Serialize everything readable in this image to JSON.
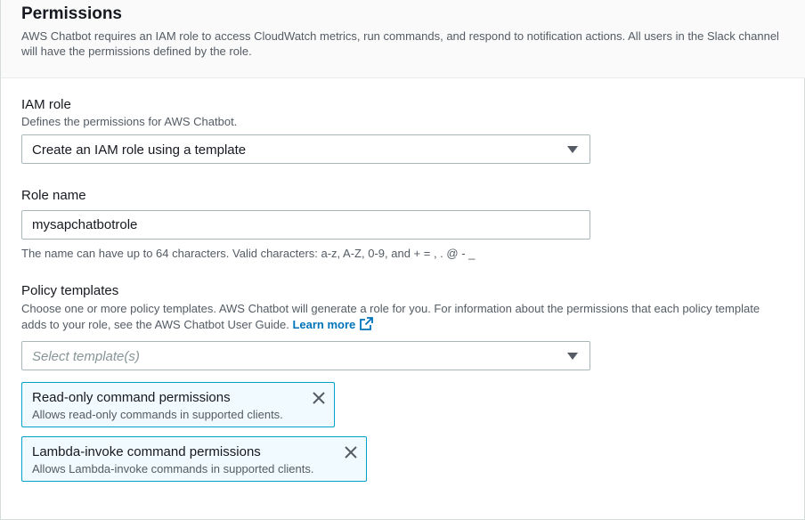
{
  "section": {
    "title": "Permissions",
    "description": "AWS Chatbot requires an IAM role to access CloudWatch metrics, run commands, and respond to notification actions. All users in the Slack channel will have the permissions defined by the role."
  },
  "iam_role": {
    "label": "IAM role",
    "description": "Defines the permissions for AWS Chatbot.",
    "selected": "Create an IAM role using a template"
  },
  "role_name": {
    "label": "Role name",
    "value": "mysapchatbotrole",
    "constraint": "The name can have up to 64 characters. Valid characters: a-z, A-Z, 0-9, and + = , . @ - _"
  },
  "policy_templates": {
    "label": "Policy templates",
    "description": "Choose one or more policy templates. AWS Chatbot will generate a role for you. For information about the permissions that each policy template adds to your role, see the AWS Chatbot User Guide.",
    "learn_more": "Learn more",
    "placeholder": "Select template(s)",
    "tokens": [
      {
        "title": "Read-only command permissions",
        "subtitle": "Allows read-only commands in supported clients."
      },
      {
        "title": "Lambda-invoke command permissions",
        "subtitle": "Allows Lambda-invoke commands in supported clients."
      }
    ]
  },
  "colors": {
    "link": "#0073bb",
    "token_border": "#00a1c9",
    "token_bg": "#f1faff"
  },
  "icons": {
    "dropdown": "caret-down-icon",
    "external": "external-link-icon",
    "dismiss": "close-icon"
  }
}
